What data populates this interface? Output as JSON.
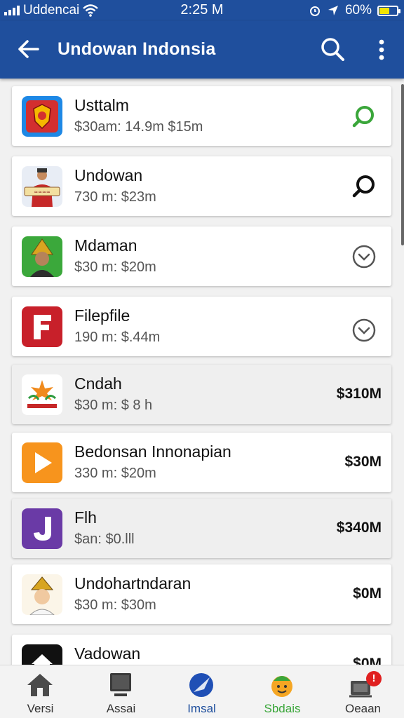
{
  "status_bar": {
    "carrier": "Uddencai",
    "time": "2:25 M",
    "battery": "60%",
    "battery_level": 0.6
  },
  "app_bar": {
    "title": "Undowan Indonsia",
    "back_icon": "arrow-left-icon",
    "search_icon": "search-icon",
    "more_icon": "more-vertical-icon"
  },
  "items": [
    {
      "name": "Usttalm",
      "meta": "$30am: 14.9m $15m",
      "icon": "emblem-icon",
      "trailing": "search-green-icon"
    },
    {
      "name": "Undowan",
      "meta": "730 m: $23m",
      "icon": "person-sign-icon",
      "trailing": "search-icon"
    },
    {
      "name": "Mdaman",
      "meta": "$30 m: $20m",
      "icon": "person-hat-icon",
      "trailing": "chevron-down-circle-icon"
    },
    {
      "name": "Filepfile",
      "meta": "190 m: $.44m",
      "icon": "letter-f-icon",
      "trailing": "chevron-down-circle-icon"
    },
    {
      "name": "Cndah",
      "meta": "$30 m: $ 8 h",
      "icon": "flower-logo-icon",
      "price": "$310M"
    },
    {
      "name": "Bedonsan Innonapian",
      "meta": "330 m: $20m",
      "icon": "play-logo-icon",
      "price": "$30M"
    },
    {
      "name": "Flh",
      "meta": "$an: $0.lll",
      "icon": "letter-j-icon",
      "price": "$340M"
    },
    {
      "name": "Undohartndaran",
      "meta": "$30 m: $30m",
      "icon": "person-hat-icon",
      "price": "$0M"
    },
    {
      "name": "Vadowan",
      "meta": "",
      "icon": "home-icon",
      "price": "$0M"
    }
  ],
  "bottom_nav": [
    {
      "label": "Versi",
      "icon": "home-icon"
    },
    {
      "label": "Assai",
      "icon": "monitor-icon"
    },
    {
      "label": "Imsal",
      "icon": "compass-icon",
      "active": true
    },
    {
      "label": "Sbdais",
      "icon": "mascot-icon"
    },
    {
      "label": "Oeaan",
      "icon": "notification-icon",
      "badge": "!"
    }
  ],
  "colors": {
    "primary": "#1f4f9d",
    "accent_green": "#3aa63a",
    "badge_red": "#e02020"
  }
}
